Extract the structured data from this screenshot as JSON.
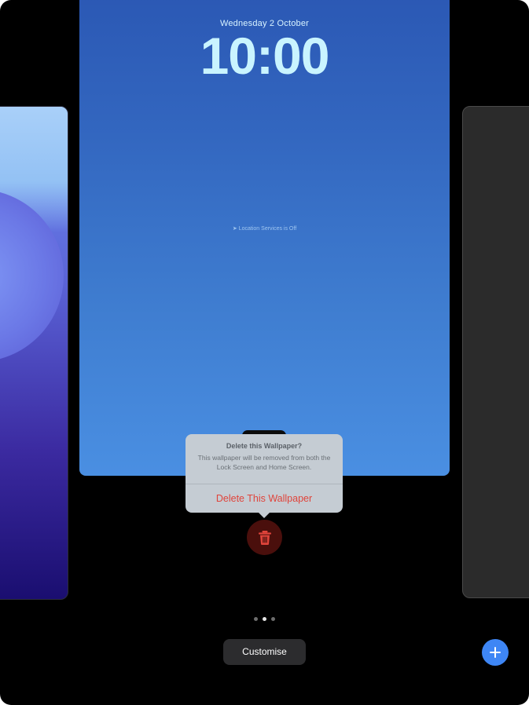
{
  "lockscreen": {
    "date": "Wednesday 2 October",
    "time": "10:00",
    "location_notice": "Location Services is Off"
  },
  "delete_popover": {
    "title": "Delete this Wallpaper?",
    "message": "This wallpaper will be removed from both the Lock Screen and Home Screen.",
    "action_label": "Delete This Wallpaper"
  },
  "pager": {
    "count": 3,
    "active_index": 1
  },
  "bottom_bar": {
    "customise_label": "Customise"
  },
  "icons": {
    "trash": "trash-icon",
    "add": "plus-icon",
    "location": "location-arrow-icon"
  },
  "colors": {
    "destructive": "#e0443b",
    "accent": "#3e86f5"
  }
}
